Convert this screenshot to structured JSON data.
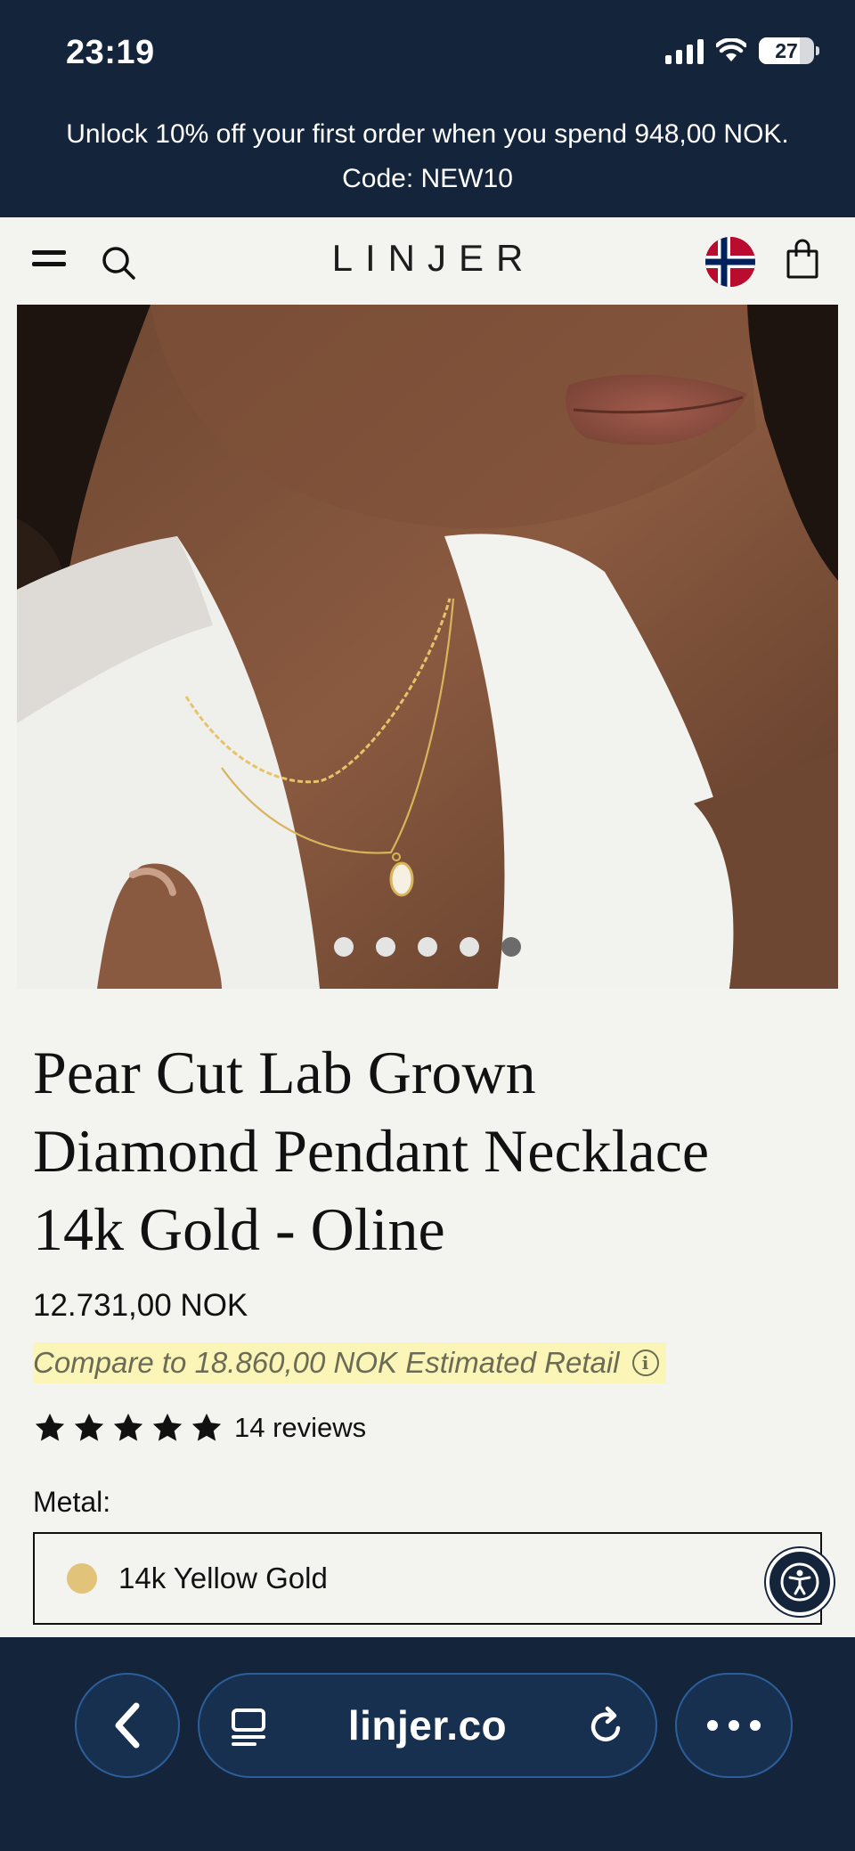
{
  "status_bar": {
    "time": "23:19",
    "battery": "27"
  },
  "promo": {
    "line1": "Unlock 10% off your first order when you spend 948,00 NOK.",
    "line2": "Code: NEW10"
  },
  "header": {
    "logo": "LINJER",
    "menu_icon": "hamburger-menu-icon",
    "search_icon": "search-icon",
    "region_icon": "norway-flag-icon",
    "cart_icon": "shopping-bag-icon"
  },
  "gallery": {
    "slide_count": 5,
    "active_slide": 5
  },
  "product": {
    "title_line1": "Pear Cut Lab Grown",
    "title_line2": "Diamond Pendant Necklace",
    "title_line3": "14k Gold - Oline",
    "price": "12.731,00 NOK",
    "compare": "Compare to 18.860,00 NOK Estimated Retail",
    "rating": 5,
    "reviews": "14 reviews",
    "metal_label": "Metal:",
    "metal_value": "14k Yellow Gold"
  },
  "browser": {
    "url": "linjer.co"
  },
  "colors": {
    "navy": "#14243a",
    "page_bg": "#f3f3f0",
    "highlight": "#fbf6b8",
    "gold_swatch": "#e2c37a"
  }
}
